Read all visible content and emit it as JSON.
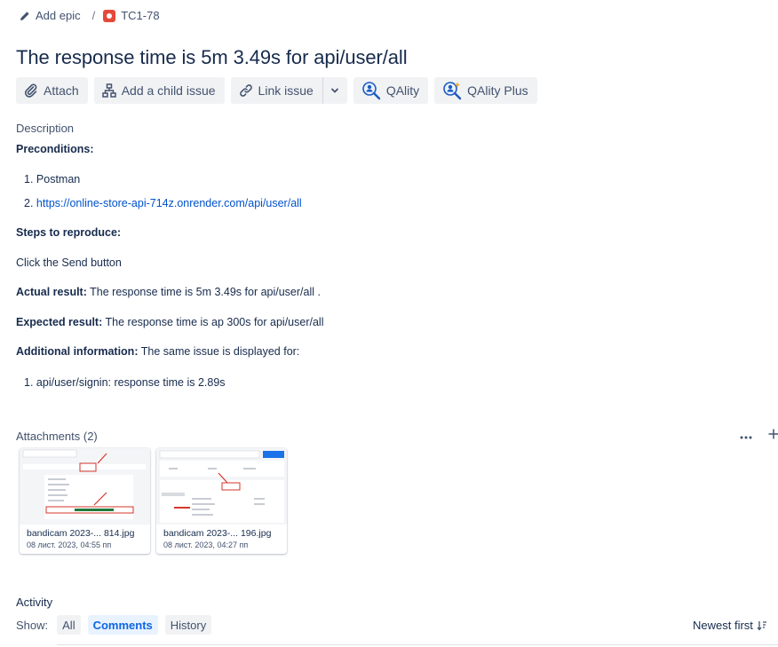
{
  "breadcrumb": {
    "epic_label": "Add epic",
    "separator": "/",
    "issue_key": "TC1-78"
  },
  "issue": {
    "title": "The response time is 5m 3.49s for api/user/all"
  },
  "toolbar": {
    "attach": "Attach",
    "add_child": "Add a child issue",
    "link_issue": "Link issue",
    "qality": "QAlity",
    "qality_plus": "QAlity Plus"
  },
  "description": {
    "label": "Description",
    "preconditions_heading": "Preconditions:",
    "preconditions": [
      {
        "num": "1.",
        "text": "Postman"
      },
      {
        "num": "2.",
        "text": "https://online-store-api-714z.onrender.com/api/user/all"
      }
    ],
    "steps_heading": "Steps to reproduce:",
    "steps_text": "Click the Send button",
    "actual_label": "Actual result:",
    "actual_text": " The response time is 5m 3.49s for api/user/all .",
    "expected_label": "Expected result:",
    "expected_text": " The response time is ap 300s for api/user/all",
    "additional_label": "Additional information:",
    "additional_text": " The same issue is displayed for:",
    "additional_items": [
      {
        "num": "1.",
        "text": "api/user/signin: response time is 2.89s"
      }
    ]
  },
  "attachments": {
    "heading": "Attachments (2)",
    "more_icon": "more-icon",
    "add_icon": "plus-icon",
    "items": [
      {
        "name": "bandicam 2023-... 814.jpg",
        "date": "08 лист. 2023, 04:55 пп"
      },
      {
        "name": "bandicam 2023-... 196.jpg",
        "date": "08 лист. 2023, 04:27 пп"
      }
    ]
  },
  "activity": {
    "heading": "Activity",
    "show_label": "Show:",
    "filters": [
      "All",
      "Comments",
      "History"
    ],
    "selected_filter": "Comments",
    "sort_label": "Newest first"
  },
  "colors": {
    "link": "#0052cc",
    "bug": "#e5493a",
    "selected_bg": "#e9f2ff",
    "selected_text": "#0c66e4"
  }
}
